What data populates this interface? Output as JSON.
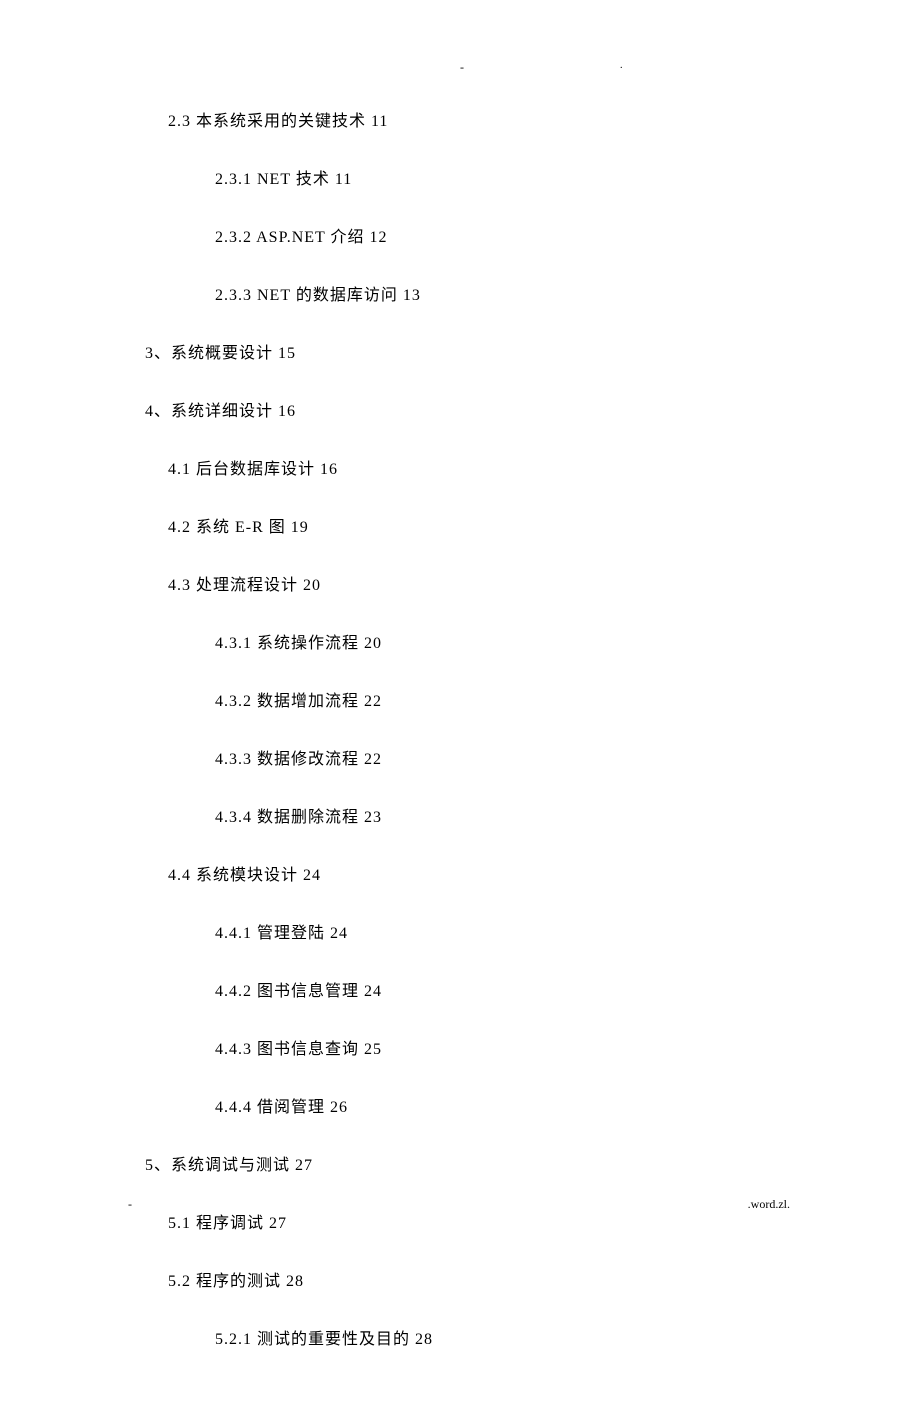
{
  "marks": {
    "center": "-",
    "right": "."
  },
  "toc": [
    {
      "level": "lvl2",
      "num": "2.3",
      "title": "本系统采用的关键技术",
      "page": "11"
    },
    {
      "level": "lvl3",
      "num": "2.3.1",
      "title": "NET 技术",
      "page": "11"
    },
    {
      "level": "lvl3",
      "num": "2.3.2",
      "title": "ASP.NET 介绍",
      "page": "12"
    },
    {
      "level": "lvl3",
      "num": "2.3.3",
      "title": "NET 的数据库访问",
      "page": "13"
    },
    {
      "level": "lvl1",
      "num": "3、",
      "title": "系统概要设计",
      "page": "15"
    },
    {
      "level": "lvl1",
      "num": "4、",
      "title": "系统详细设计",
      "page": "16"
    },
    {
      "level": "lvl2",
      "num": "4.1",
      "title": "后台数据库设计",
      "page": "16"
    },
    {
      "level": "lvl2",
      "num": "4.2",
      "title": "系统 E-R 图",
      "page": "19"
    },
    {
      "level": "lvl2",
      "num": "4.3",
      "title": "处理流程设计",
      "page": "20"
    },
    {
      "level": "lvl3",
      "num": "4.3.1",
      "title": "系统操作流程",
      "page": "20"
    },
    {
      "level": "lvl3",
      "num": "4.3.2",
      "title": "数据增加流程",
      "page": "22"
    },
    {
      "level": "lvl3",
      "num": "4.3.3",
      "title": "数据修改流程",
      "page": "22"
    },
    {
      "level": "lvl3",
      "num": "4.3.4",
      "title": "数据删除流程",
      "page": "23"
    },
    {
      "level": "lvl2",
      "num": "4.4",
      "title": "系统模块设计",
      "page": "24"
    },
    {
      "level": "lvl3",
      "num": "4.4.1",
      "title": "管理登陆",
      "page": "24"
    },
    {
      "level": "lvl3",
      "num": "4.4.2",
      "title": "图书信息管理",
      "page": "24"
    },
    {
      "level": "lvl3",
      "num": "4.4.3",
      "title": "图书信息查询",
      "page": "25"
    },
    {
      "level": "lvl3",
      "num": "4.4.4",
      "title": "借阅管理",
      "page": "26"
    },
    {
      "level": "lvl1",
      "num": "5、",
      "title": "系统调试与测试",
      "page": "27"
    },
    {
      "level": "lvl2",
      "num": "5.1",
      "title": "程序调试",
      "page": "27"
    },
    {
      "level": "lvl2",
      "num": "5.2",
      "title": "程序的测试",
      "page": "28"
    },
    {
      "level": "lvl3",
      "num": "5.2.1",
      "title": "测试的重要性及目的",
      "page": "28"
    }
  ],
  "footer": {
    "left": "-",
    "right": ".word.zl."
  }
}
